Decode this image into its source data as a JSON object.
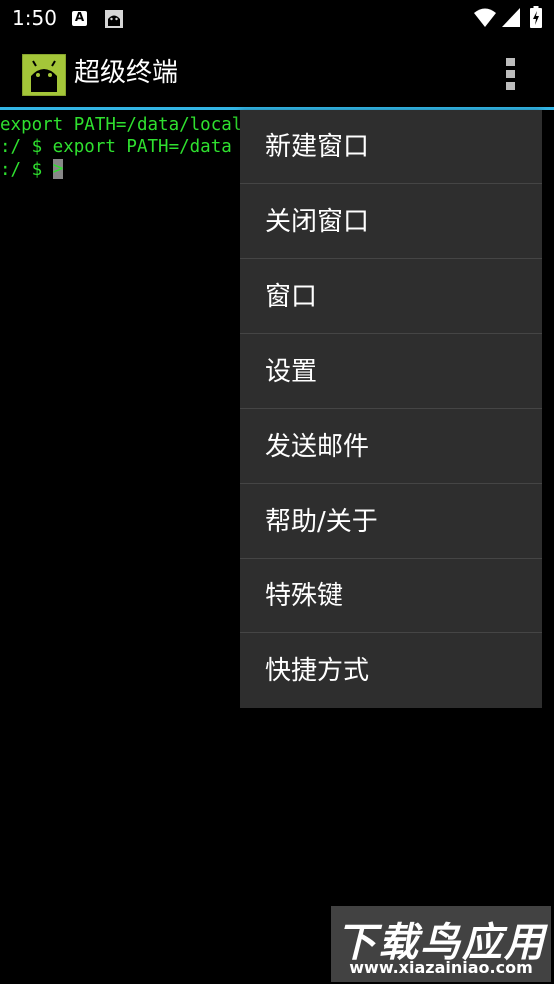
{
  "status_bar": {
    "time": "1:50",
    "notification_letter": "A",
    "icons": [
      "a-badge-icon",
      "android-notification-icon",
      "wifi-icon",
      "signal-icon",
      "battery-charging-icon"
    ]
  },
  "app_bar": {
    "title": "超级终端",
    "icon": "android-app-icon",
    "overflow_icon": "overflow-menu-icon",
    "accent_color": "#33b5e5"
  },
  "terminal": {
    "text_color": "#2fe02f",
    "lines": [
      "export PATH=/data/local",
      ":/ $ export PATH=/data",
      ":/ $ "
    ],
    "cursor_char": ">"
  },
  "menu": {
    "items": [
      {
        "label": "新建窗口"
      },
      {
        "label": "关闭窗口"
      },
      {
        "label": "窗口"
      },
      {
        "label": "设置"
      },
      {
        "label": "发送邮件"
      },
      {
        "label": "帮助/关于"
      },
      {
        "label": "特殊键"
      },
      {
        "label": "快捷方式"
      }
    ]
  },
  "watermark": {
    "main": "下载鸟应用",
    "url": "www.xiazainiao.com"
  }
}
